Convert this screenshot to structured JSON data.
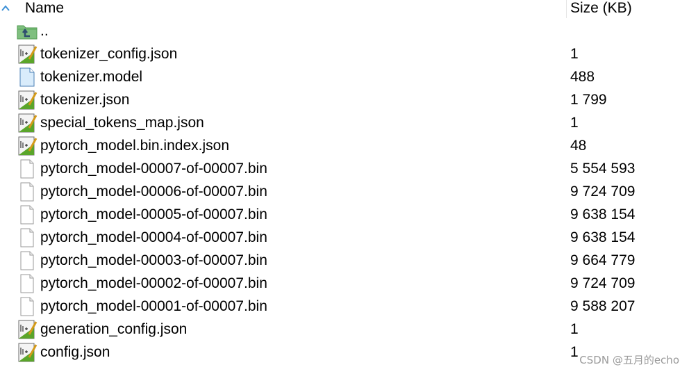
{
  "header": {
    "name_label": "Name",
    "size_label": "Size (KB)"
  },
  "files": [
    {
      "name": "..",
      "size": "",
      "icon": "parent-folder-icon"
    },
    {
      "name": "tokenizer_config.json",
      "size": "1",
      "icon": "json-file-icon"
    },
    {
      "name": "tokenizer.model",
      "size": "488",
      "icon": "model-file-icon"
    },
    {
      "name": "tokenizer.json",
      "size": "1 799",
      "icon": "json-file-icon"
    },
    {
      "name": "special_tokens_map.json",
      "size": "1",
      "icon": "json-file-icon"
    },
    {
      "name": "pytorch_model.bin.index.json",
      "size": "48",
      "icon": "json-file-icon"
    },
    {
      "name": "pytorch_model-00007-of-00007.bin",
      "size": "5 554 593",
      "icon": "bin-file-icon"
    },
    {
      "name": "pytorch_model-00006-of-00007.bin",
      "size": "9 724 709",
      "icon": "bin-file-icon"
    },
    {
      "name": "pytorch_model-00005-of-00007.bin",
      "size": "9 638 154",
      "icon": "bin-file-icon"
    },
    {
      "name": "pytorch_model-00004-of-00007.bin",
      "size": "9 638 154",
      "icon": "bin-file-icon"
    },
    {
      "name": "pytorch_model-00003-of-00007.bin",
      "size": "9 664 779",
      "icon": "bin-file-icon"
    },
    {
      "name": "pytorch_model-00002-of-00007.bin",
      "size": "9 724 709",
      "icon": "bin-file-icon"
    },
    {
      "name": "pytorch_model-00001-of-00007.bin",
      "size": "9 588 207",
      "icon": "bin-file-icon"
    },
    {
      "name": "generation_config.json",
      "size": "1",
      "icon": "json-file-icon"
    },
    {
      "name": "config.json",
      "size": "1",
      "icon": "json-file-icon"
    }
  ],
  "watermark": "CSDN @五月的echo"
}
